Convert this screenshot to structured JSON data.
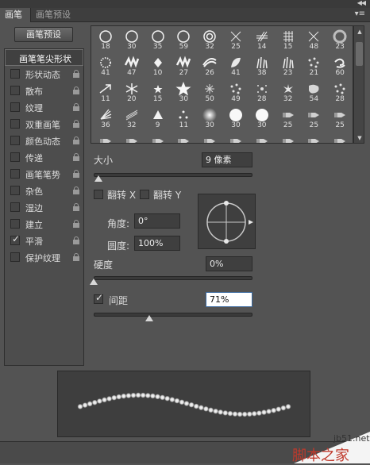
{
  "tabs": [
    {
      "label": "画笔"
    },
    {
      "label": "画笔预设"
    }
  ],
  "preset_button": "画笔预设",
  "left_list": [
    {
      "label": "画笔笔尖形状",
      "checked": false,
      "selected": true,
      "has_checkbox": false,
      "locked": false
    },
    {
      "label": "形状动态",
      "checked": false,
      "selected": false,
      "has_checkbox": true,
      "locked": true
    },
    {
      "label": "散布",
      "checked": false,
      "selected": false,
      "has_checkbox": true,
      "locked": true
    },
    {
      "label": "纹理",
      "checked": false,
      "selected": false,
      "has_checkbox": true,
      "locked": true
    },
    {
      "label": "双重画笔",
      "checked": false,
      "selected": false,
      "has_checkbox": true,
      "locked": true
    },
    {
      "label": "颜色动态",
      "checked": false,
      "selected": false,
      "has_checkbox": true,
      "locked": true
    },
    {
      "label": "传递",
      "checked": false,
      "selected": false,
      "has_checkbox": true,
      "locked": true
    },
    {
      "label": "画笔笔势",
      "checked": false,
      "selected": false,
      "has_checkbox": true,
      "locked": true
    },
    {
      "label": "杂色",
      "checked": false,
      "selected": false,
      "has_checkbox": true,
      "locked": true
    },
    {
      "label": "湿边",
      "checked": false,
      "selected": false,
      "has_checkbox": true,
      "locked": true
    },
    {
      "label": "建立",
      "checked": false,
      "selected": false,
      "has_checkbox": true,
      "locked": true
    },
    {
      "label": "平滑",
      "checked": true,
      "selected": false,
      "has_checkbox": true,
      "locked": true
    },
    {
      "label": "保护纹理",
      "checked": false,
      "selected": false,
      "has_checkbox": true,
      "locked": true
    }
  ],
  "brush_grid": {
    "rows": [
      [
        {
          "n": "18",
          "s": "ring"
        },
        {
          "n": "30",
          "s": "ring"
        },
        {
          "n": "35",
          "s": "ring"
        },
        {
          "n": "59",
          "s": "ring"
        },
        {
          "n": "32",
          "s": "target"
        },
        {
          "n": "25",
          "s": "cross"
        },
        {
          "n": "14",
          "s": "hatch"
        },
        {
          "n": "15",
          "s": "grid"
        },
        {
          "n": "48",
          "s": "cross"
        },
        {
          "n": "23",
          "s": "ring-soft"
        }
      ],
      [
        {
          "n": "41",
          "s": "dot-ring"
        },
        {
          "n": "47",
          "s": "zigzag"
        },
        {
          "n": "10",
          "s": "diamond"
        },
        {
          "n": "27",
          "s": "zigzag"
        },
        {
          "n": "26",
          "s": "swoosh"
        },
        {
          "n": "41",
          "s": "leaf"
        },
        {
          "n": "38",
          "s": "grass"
        },
        {
          "n": "23",
          "s": "grass"
        },
        {
          "n": "21",
          "s": "dots"
        },
        {
          "n": "60",
          "s": "swirl"
        }
      ],
      [
        {
          "n": "11",
          "s": "arrow"
        },
        {
          "n": "20",
          "s": "snowflake"
        },
        {
          "n": "15",
          "s": "star-small"
        },
        {
          "n": "30",
          "s": "star"
        },
        {
          "n": "50",
          "s": "sparkle"
        },
        {
          "n": "49",
          "s": "dots"
        },
        {
          "n": "28",
          "s": "burst"
        },
        {
          "n": "32",
          "s": "flower"
        },
        {
          "n": "54",
          "s": "splat"
        },
        {
          "n": "28",
          "s": "dots"
        }
      ],
      [
        {
          "n": "36",
          "s": "fan"
        },
        {
          "n": "32",
          "s": "lines"
        },
        {
          "n": "9",
          "s": "triangle"
        },
        {
          "n": "11",
          "s": "dots3"
        },
        {
          "n": "30",
          "s": "soft"
        },
        {
          "n": "30",
          "s": "hard"
        },
        {
          "n": "30",
          "s": "hard"
        },
        {
          "n": "25",
          "s": "tip"
        },
        {
          "n": "25",
          "s": "tip"
        },
        {
          "n": "25",
          "s": "tip"
        }
      ],
      [
        {
          "n": "",
          "s": "tip"
        },
        {
          "n": "",
          "s": "tip"
        },
        {
          "n": "",
          "s": "tip"
        },
        {
          "n": "",
          "s": "tip"
        },
        {
          "n": "",
          "s": "tip"
        },
        {
          "n": "",
          "s": "tip"
        },
        {
          "n": "",
          "s": "tip"
        },
        {
          "n": "",
          "s": "tip"
        },
        {
          "n": "",
          "s": "tip"
        },
        {
          "n": "",
          "s": "tip"
        }
      ]
    ]
  },
  "size": {
    "label": "大小",
    "value": "9 像素",
    "slider_fraction": 0.03
  },
  "flip_x": {
    "label": "翻转 X",
    "checked": false
  },
  "flip_y": {
    "label": "翻转 Y",
    "checked": false
  },
  "angle": {
    "label": "角度:",
    "value": "0°"
  },
  "roundness": {
    "label": "圆度:",
    "value": "100%"
  },
  "hardness": {
    "label": "硬度",
    "value": "0%",
    "slider_fraction": 0.0
  },
  "spacing": {
    "label": "间距",
    "value": "71%",
    "checked": true,
    "slider_fraction": 0.35
  },
  "watermark": {
    "url": "jb51.net",
    "text": "脚本之家"
  }
}
